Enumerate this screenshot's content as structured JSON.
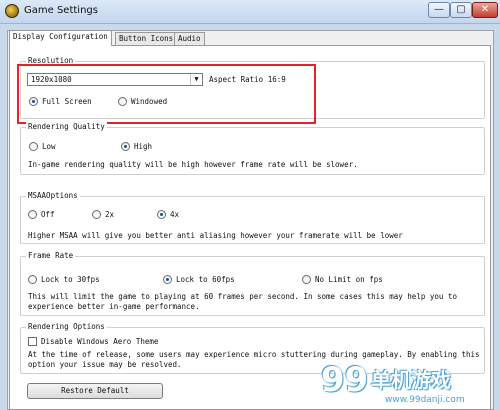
{
  "window": {
    "title": "Game Settings",
    "min": "—",
    "max": "▢",
    "close": "✕"
  },
  "tabs": [
    "Display Configuration",
    "Button Icons",
    "Audio"
  ],
  "resolution": {
    "group_title": "Resolution",
    "selected": "1920x1080",
    "aspect_label": "Aspect Ratio 16:9",
    "modes": [
      "Full Screen",
      "Windowed"
    ],
    "selected_mode": "Full Screen"
  },
  "rendering_quality": {
    "group_title": "Rendering Quality",
    "options": [
      "Low",
      "High"
    ],
    "selected": "High",
    "description": "In-game rendering quality will be high however frame rate will be slower."
  },
  "msaa": {
    "group_title": "MSAAOptions",
    "options": [
      "Off",
      "2x",
      "4x"
    ],
    "selected": "4x",
    "description": "Higher MSAA will give you better anti aliasing however your framerate will be lower"
  },
  "frame_rate": {
    "group_title": "Frame Rate",
    "options": [
      "Lock  to 30fps",
      "Lock to 60fps",
      "No Limit on fps"
    ],
    "selected": "Lock to 60fps",
    "description_lines": [
      "This will limit the game to playing at 60 frames per second. In some cases this may help you to",
      "experience better in-game performance."
    ]
  },
  "rendering_options": {
    "group_title": "Rendering Options",
    "checkbox_label": "Disable Windows Aero Theme",
    "checked": false,
    "description_lines": [
      "At the time of release, some users may experience micro stuttering during gameplay. By enabling this",
      "option your issue may be resolved."
    ]
  },
  "restore_button": "Restore Default",
  "watermark": {
    "number": "99",
    "brand": "单机游戏",
    "url": "www.99danji.com"
  }
}
